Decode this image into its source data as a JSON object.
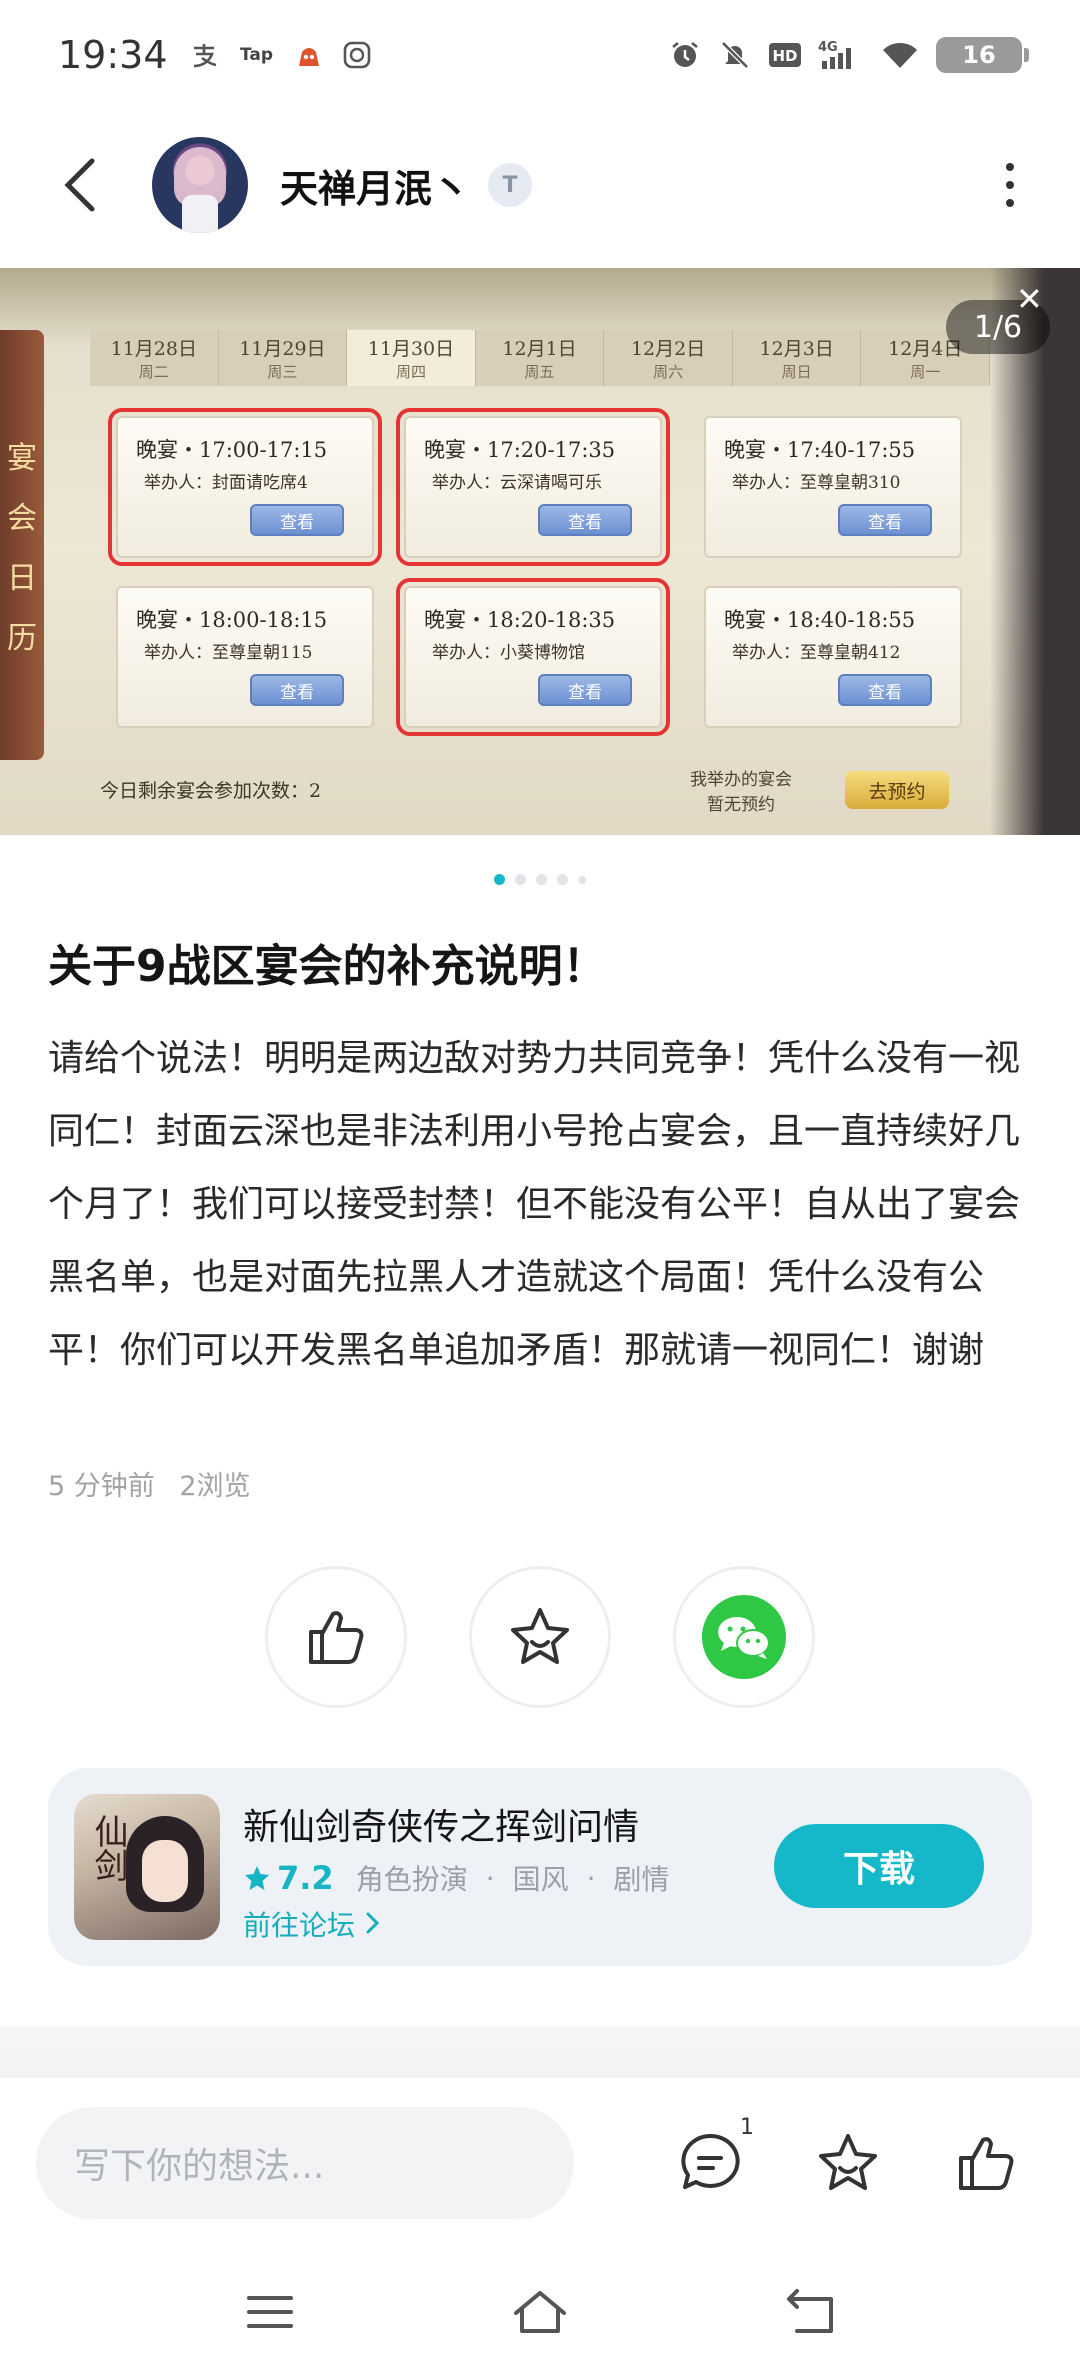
{
  "status_bar": {
    "time": "19:34",
    "left_icons": [
      "alipay-icon",
      "taptap-icon",
      "app-icon",
      "camera-icon"
    ],
    "tap_label": "Tap",
    "right_icons": [
      "alarm-icon",
      "mute-icon",
      "hd-icon",
      "signal-4g-icon",
      "wifi-icon"
    ],
    "network": "4G",
    "battery": "16"
  },
  "header": {
    "username": "天禅月泯丶",
    "level_badge": "T"
  },
  "carousel": {
    "counter": "1/6",
    "active_index": 0,
    "total_dots": 5,
    "close_label": "✕",
    "image": {
      "side_title": [
        "宴",
        "会",
        "日",
        "历"
      ],
      "days": [
        {
          "date": "11月28日",
          "weekday": "周二"
        },
        {
          "date": "11月29日",
          "weekday": "周三"
        },
        {
          "date": "11月30日",
          "weekday": "周四"
        },
        {
          "date": "12月1日",
          "weekday": "周五"
        },
        {
          "date": "12月2日",
          "weekday": "周六"
        },
        {
          "date": "12月3日",
          "weekday": "周日"
        },
        {
          "date": "12月4日",
          "weekday": "周一"
        }
      ],
      "feasts": [
        {
          "time": "晚宴・17:00-17:15",
          "host": "举办人：封面请吃席4",
          "button": "查看"
        },
        {
          "time": "晚宴・17:20-17:35",
          "host": "举办人：云深请喝可乐",
          "button": "查看"
        },
        {
          "time": "晚宴・17:40-17:55",
          "host": "举办人：至尊皇朝310",
          "button": "查看"
        },
        {
          "time": "晚宴・18:00-18:15",
          "host": "举办人：至尊皇朝115",
          "button": "查看"
        },
        {
          "time": "晚宴・18:20-18:35",
          "host": "举办人：小葵博物馆",
          "button": "查看"
        },
        {
          "time": "晚宴・18:40-18:55",
          "host": "举办人：至尊皇朝412",
          "button": "查看"
        }
      ],
      "remaining": "今日剩余宴会参加次数：2",
      "my_feast_line1": "我举办的宴会",
      "my_feast_line2": "暂无预约",
      "book_button": "去预约"
    }
  },
  "post": {
    "title": "关于9战区宴会的补充说明！",
    "body": "请给个说法！明明是两边敌对势力共同竞争！凭什么没有一视同仁！封面云深也是非法利用小号抢占宴会，且一直持续好几个月了！我们可以接受封禁！但不能没有公平！自从出了宴会黑名单，也是对面先拉黑人才造就这个局面！凭什么没有公平！你们可以开发黑名单追加矛盾！那就请一视同仁！谢谢",
    "time_ago": "5 分钟前",
    "views": "2浏览"
  },
  "game_card": {
    "name": "新仙剑奇侠传之挥剑问情",
    "icon_text": "仙剑",
    "rating": "7.2",
    "tags": [
      "角色扮演",
      "国风",
      "剧情"
    ],
    "tag_separator": "·",
    "forum_link": "前往论坛 ",
    "download": "下载"
  },
  "comment_bar": {
    "placeholder": "写下你的想法...",
    "comment_count": "1"
  },
  "colors": {
    "accent": "#14b8c8",
    "wechat": "#2ec845",
    "highlight_red": "#e53434"
  }
}
